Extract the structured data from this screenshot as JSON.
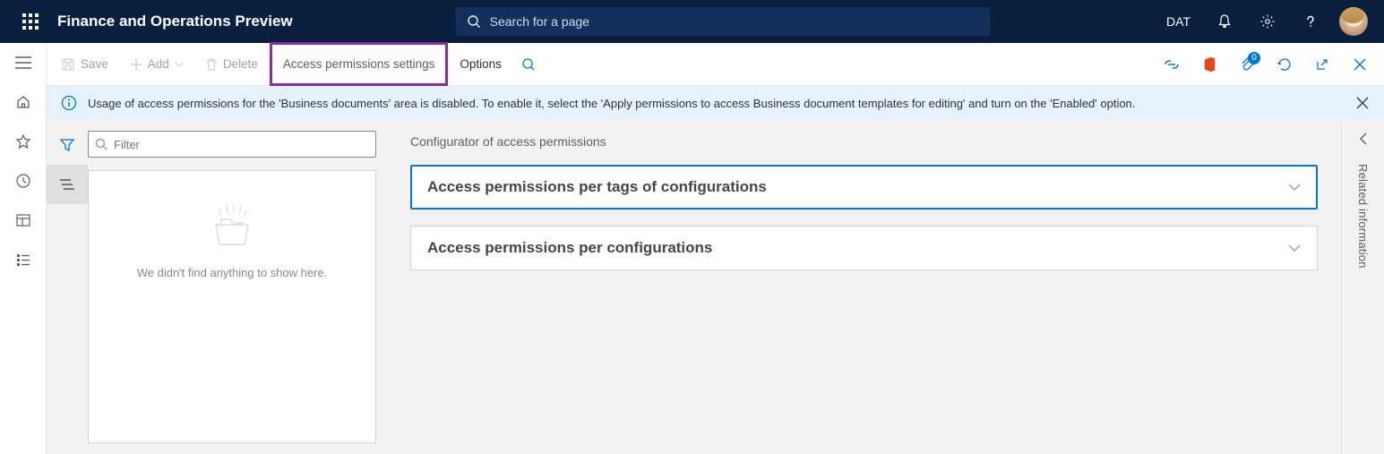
{
  "top": {
    "app_title": "Finance and Operations Preview",
    "search_placeholder": "Search for a page",
    "company": "DAT"
  },
  "cmd": {
    "save": "Save",
    "add": "Add",
    "delete": "Delete",
    "access_permissions": "Access permissions settings",
    "options": "Options",
    "attachment_badge": "0"
  },
  "info": {
    "message": "Usage of access permissions for the 'Business documents' area is disabled. To enable it, select the 'Apply permissions to access Business document templates for editing' and turn on the 'Enabled' option."
  },
  "list": {
    "filter_placeholder": "Filter",
    "empty_text": "We didn't find anything to show here."
  },
  "configurator": {
    "title": "Configurator of access permissions",
    "section1": "Access permissions per tags of configurations",
    "section2": "Access permissions per configurations"
  },
  "rightstrip": {
    "label": "Related information"
  }
}
